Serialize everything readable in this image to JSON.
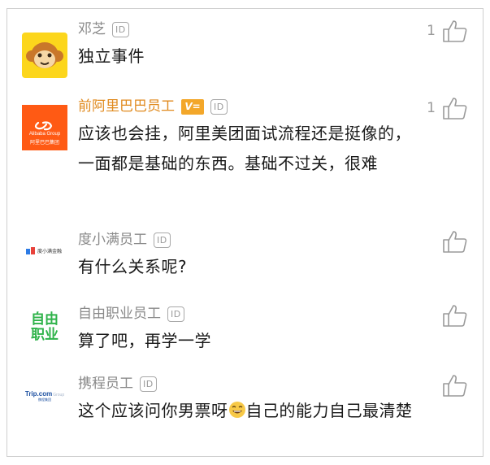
{
  "comments": [
    {
      "name": "邓芝",
      "id_badge": "ID",
      "text": "独立事件",
      "likes": "1",
      "avatar": "monkey-mascot-avatar"
    },
    {
      "name": "前阿里巴巴员工",
      "id_badge": "ID",
      "verified_badge": "V=",
      "text": "应该也会挂，阿里美团面试流程还是挺像的，一面都是基础的东西。基础不过关，很难",
      "likes": "1",
      "avatar": {
        "logo": "alibaba-logo",
        "logo_text": "Alibaba Group",
        "logo_sub": "阿里巴巴集团"
      }
    },
    {
      "name": "度小满员工",
      "id_badge": "ID",
      "text": "有什么关系呢?",
      "likes": "",
      "avatar": {
        "logo": "duxiaoman-logo",
        "logo_text": "度小满金融"
      }
    },
    {
      "name": "自由职业员工",
      "id_badge": "ID",
      "text": "算了吧，再学一学",
      "likes": "",
      "avatar": {
        "logo": "freelance-logo",
        "line1": "自由",
        "line2": "职业"
      }
    },
    {
      "name": "携程员工",
      "id_badge": "ID",
      "text_before_emoji": "这个应该问你男票呀",
      "text_after_emoji": "自己的能力自己最清楚",
      "likes": "",
      "avatar": {
        "logo": "trip-com-logo",
        "logo_text": "Trip.com",
        "logo_suffix": "Group",
        "logo_sub": "携程集团"
      }
    }
  ],
  "colors": {
    "name_gray": "#8a8a8a",
    "vip_orange": "#e08a1e",
    "text": "#1a1a1a",
    "alibaba_orange": "#ff5a14",
    "freelance_green": "#2fb34a"
  }
}
